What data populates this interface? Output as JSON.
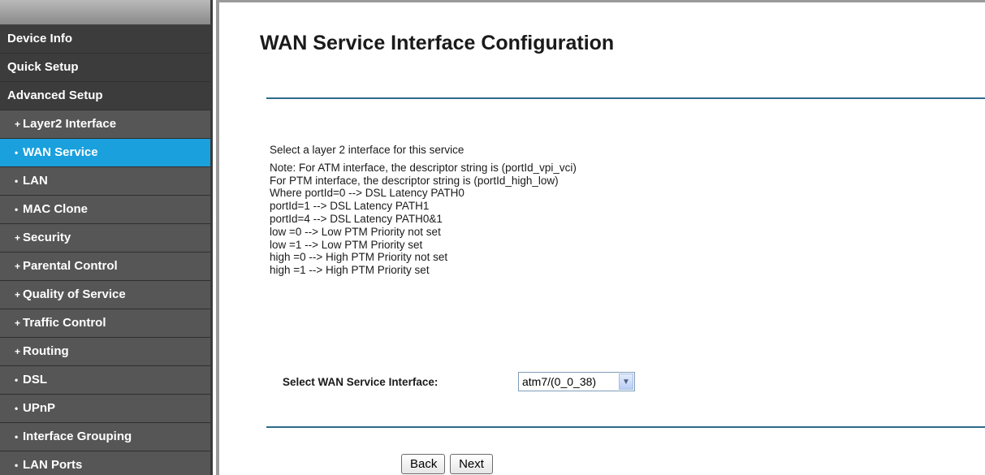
{
  "sidebar": {
    "items": [
      {
        "label": "Device Info",
        "type": "main"
      },
      {
        "label": "Quick Setup",
        "type": "main"
      },
      {
        "label": "Advanced Setup",
        "type": "main"
      },
      {
        "label": "Layer2 Interface",
        "type": "sub",
        "bullet": "+"
      },
      {
        "label": "WAN Service",
        "type": "sub",
        "bullet": "•",
        "active": true
      },
      {
        "label": "LAN",
        "type": "sub",
        "bullet": "•"
      },
      {
        "label": "MAC Clone",
        "type": "sub",
        "bullet": "•"
      },
      {
        "label": "Security",
        "type": "sub",
        "bullet": "+"
      },
      {
        "label": "Parental Control",
        "type": "sub",
        "bullet": "+"
      },
      {
        "label": "Quality of Service",
        "type": "sub",
        "bullet": "+"
      },
      {
        "label": "Traffic Control",
        "type": "sub",
        "bullet": "+"
      },
      {
        "label": "Routing",
        "type": "sub",
        "bullet": "+"
      },
      {
        "label": "DSL",
        "type": "sub",
        "bullet": "•"
      },
      {
        "label": "UPnP",
        "type": "sub",
        "bullet": "•"
      },
      {
        "label": "Interface Grouping",
        "type": "sub",
        "bullet": "•"
      },
      {
        "label": "LAN Ports",
        "type": "sub",
        "bullet": "•"
      }
    ]
  },
  "main": {
    "title": "WAN Service Interface Configuration",
    "intro": "Select a layer 2 interface for this service",
    "notes": [
      "Note: For ATM interface, the descriptor string is (portId_vpi_vci)",
      "For PTM interface, the descriptor string is (portId_high_low)",
      "Where portId=0 --> DSL Latency PATH0",
      "portId=1 --> DSL Latency PATH1",
      "portId=4 --> DSL Latency PATH0&1",
      "low =0 --> Low PTM Priority not set",
      "low =1 --> Low PTM Priority set",
      "high =0 --> High PTM Priority not set",
      "high =1 --> High PTM Priority set"
    ],
    "select_label": "Select WAN Service Interface:",
    "select_value": "atm7/(0_0_38)",
    "back_label": "Back",
    "next_label": "Next"
  },
  "colors": {
    "active_item": "#1aa0dd",
    "main_item": "#3c3c3c",
    "sub_item": "#565656",
    "divider": "#2e6a8a"
  },
  "icons": {
    "dropdown": "chevron-down-icon"
  }
}
